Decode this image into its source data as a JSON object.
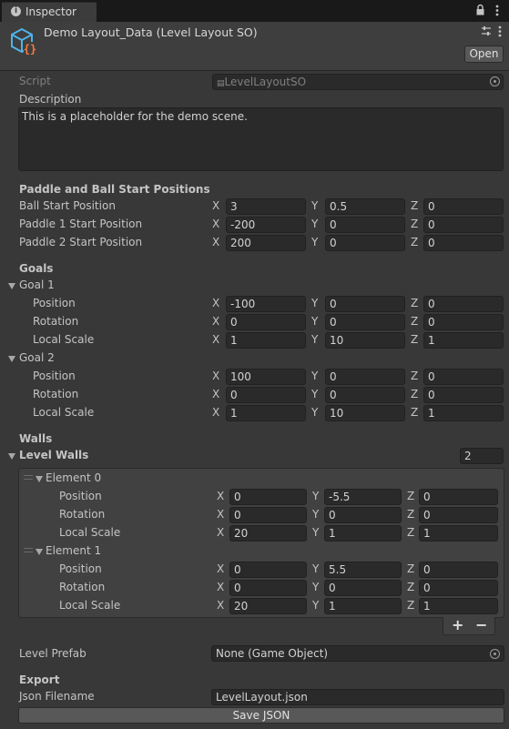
{
  "tab": {
    "label": "Inspector"
  },
  "header": {
    "title": "Demo Layout_Data (Level Layout SO)",
    "open_label": "Open"
  },
  "script": {
    "label": "Script",
    "value": "LevelLayoutSO"
  },
  "description": {
    "label": "Description",
    "value": "This is a placeholder for the demo scene."
  },
  "paddles": {
    "heading": "Paddle and Ball Start Positions",
    "rows": [
      {
        "label": "Ball Start Position",
        "x": "3",
        "y": "0.5",
        "z": "0"
      },
      {
        "label": "Paddle 1 Start Position",
        "x": "-200",
        "y": "0",
        "z": "0"
      },
      {
        "label": "Paddle 2 Start Position",
        "x": "200",
        "y": "0",
        "z": "0"
      }
    ]
  },
  "goals": {
    "heading": "Goals",
    "goal1": {
      "label": "Goal 1",
      "position": {
        "label": "Position",
        "x": "-100",
        "y": "0",
        "z": "0"
      },
      "rotation": {
        "label": "Rotation",
        "x": "0",
        "y": "0",
        "z": "0"
      },
      "scale": {
        "label": "Local Scale",
        "x": "1",
        "y": "10",
        "z": "1"
      }
    },
    "goal2": {
      "label": "Goal 2",
      "position": {
        "label": "Position",
        "x": "100",
        "y": "0",
        "z": "0"
      },
      "rotation": {
        "label": "Rotation",
        "x": "0",
        "y": "0",
        "z": "0"
      },
      "scale": {
        "label": "Local Scale",
        "x": "1",
        "y": "10",
        "z": "1"
      }
    }
  },
  "walls": {
    "heading": "Walls",
    "list_label": "Level Walls",
    "count": "2",
    "elements": [
      {
        "label": "Element 0",
        "position": {
          "label": "Position",
          "x": "0",
          "y": "-5.5",
          "z": "0"
        },
        "rotation": {
          "label": "Rotation",
          "x": "0",
          "y": "0",
          "z": "0"
        },
        "scale": {
          "label": "Local Scale",
          "x": "20",
          "y": "1",
          "z": "1"
        }
      },
      {
        "label": "Element 1",
        "position": {
          "label": "Position",
          "x": "0",
          "y": "5.5",
          "z": "0"
        },
        "rotation": {
          "label": "Rotation",
          "x": "0",
          "y": "0",
          "z": "0"
        },
        "scale": {
          "label": "Local Scale",
          "x": "20",
          "y": "1",
          "z": "1"
        }
      }
    ],
    "add_label": "+",
    "remove_label": "−"
  },
  "prefab": {
    "label": "Level Prefab",
    "value": "None (Game Object)"
  },
  "export": {
    "heading": "Export",
    "filename_label": "Json Filename",
    "filename_value": "LevelLayout.json",
    "save_label": "Save JSON"
  },
  "axes": {
    "x": "X",
    "y": "Y",
    "z": "Z"
  },
  "icons": {
    "asset": "scriptable-object-icon",
    "lock": "lock-icon",
    "menu": "kebab-menu-icon",
    "preset": "preset-icon",
    "picker": "object-picker-icon"
  },
  "colors": {
    "background": "#383838",
    "field": "#2a2a2a",
    "text": "#c4c4c4",
    "asset_icon": "#4fb3e8"
  }
}
